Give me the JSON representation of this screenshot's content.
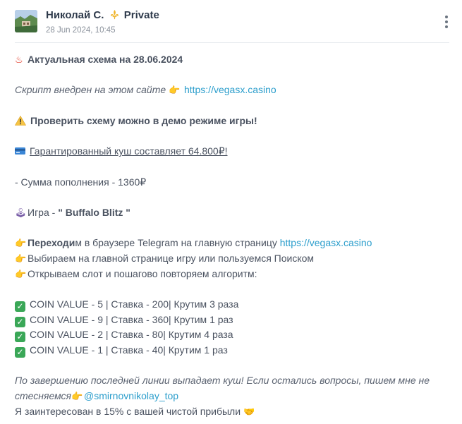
{
  "post": {
    "author": "Николай С.",
    "badge": "Private",
    "date": "28 Jun 2024, 10:45"
  },
  "icons": {
    "avatar": "landscape-avatar",
    "badge": "fleur-de-lis-icon",
    "menu": "vertical-dots-icon"
  },
  "content": {
    "l1": {
      "icon": "♨",
      "text": "Актуальная схема на 28.06.2024"
    },
    "l2": {
      "text": "Скрипт внедрен на этом сайте ",
      "icon": "👉",
      "link": "https://vegasx.casino"
    },
    "l3": {
      "text": "Проверить схему можно в демо режиме игры!"
    },
    "l4": {
      "text": "Гарантированный куш составляет 64.800₽!"
    },
    "l5": {
      "text": "- Сумма пополнения - 1360₽"
    },
    "l6": {
      "icon": "🕹",
      "prefix": "Игра - ",
      "game": "\" Buffalo Blitz \""
    },
    "l7": {
      "icon": "👉",
      "bold": "Переходи",
      "text": "м в браузере Telegram на главную страницу ",
      "link": "https://vegasx.casino"
    },
    "l8": {
      "icon": "👉",
      "text": "Выбираем на главной странице игру или пользуемся Поиском"
    },
    "l9": {
      "icon": "👉",
      "text": "Открываем слот и пошагово повторяем алгоритм:"
    },
    "steps": [
      "COIN VALUE - 5 | Ставка - 200| Крутим 3 раза",
      "COIN VALUE - 9 | Ставка - 360| Крутим 1 раз",
      "COIN VALUE - 2 | Ставка - 80| Крутим 4 раза",
      "COIN VALUE - 1 | Ставка - 40| Крутим 1 раз"
    ],
    "check_icon": "✓",
    "f1": "По завершению последней линии выпадает куш! Если остались вопросы, пишем мне не",
    "f2": {
      "text": "стесняемся",
      "icon": "👉",
      "mention": "@smirnovnikolay_top"
    },
    "f3": {
      "text": "Я заинтересован в 15% с вашей чистой прибыли ",
      "icon": "🤝"
    }
  }
}
